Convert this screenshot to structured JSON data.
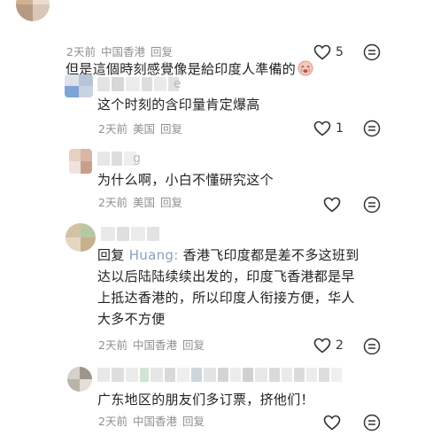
{
  "comments": [
    {
      "name_tail": "",
      "text": "但是這個時刻感覺像是給印度人準備的",
      "time": "2天前",
      "location": "中国香港",
      "reply_label": "回复",
      "likes": "5",
      "emoji": "crying-face-icon"
    },
    {
      "name_tail": "e",
      "text": "这个时刻的含印量肯定爆高",
      "time": "2天前",
      "location": "美国",
      "reply_label": "回复",
      "likes": "1"
    },
    {
      "name_tail": "g",
      "text": "为什么啊，小白不懂研究这个",
      "time": "2天前",
      "location": "美国",
      "reply_label": "回复",
      "likes": ""
    },
    {
      "name_tail": "",
      "reply_prefix": "回复",
      "reply_to": "Huang:",
      "text": "香港飞印度都是差不多这班到\n达以后陆陆续续出发的，印度飞香港都是早\n上抵达香港的，所以印度人衔接方便，华人\n大多不方便",
      "time": "2天前",
      "location": "中国香港",
      "reply_label": "回复",
      "likes": "2"
    },
    {
      "name_tail": "",
      "text": "广东地区的朋友们多订票，挤他们！",
      "time": "2天前",
      "location": "中国香港",
      "reply_label": "回复",
      "likes": ""
    }
  ],
  "icons": {
    "like": "heart-outline-icon",
    "more": "more-options-icon"
  },
  "colors": {
    "text": "#222222",
    "meta": "#8f8f8f",
    "reply_name": "#8aa0bf"
  }
}
